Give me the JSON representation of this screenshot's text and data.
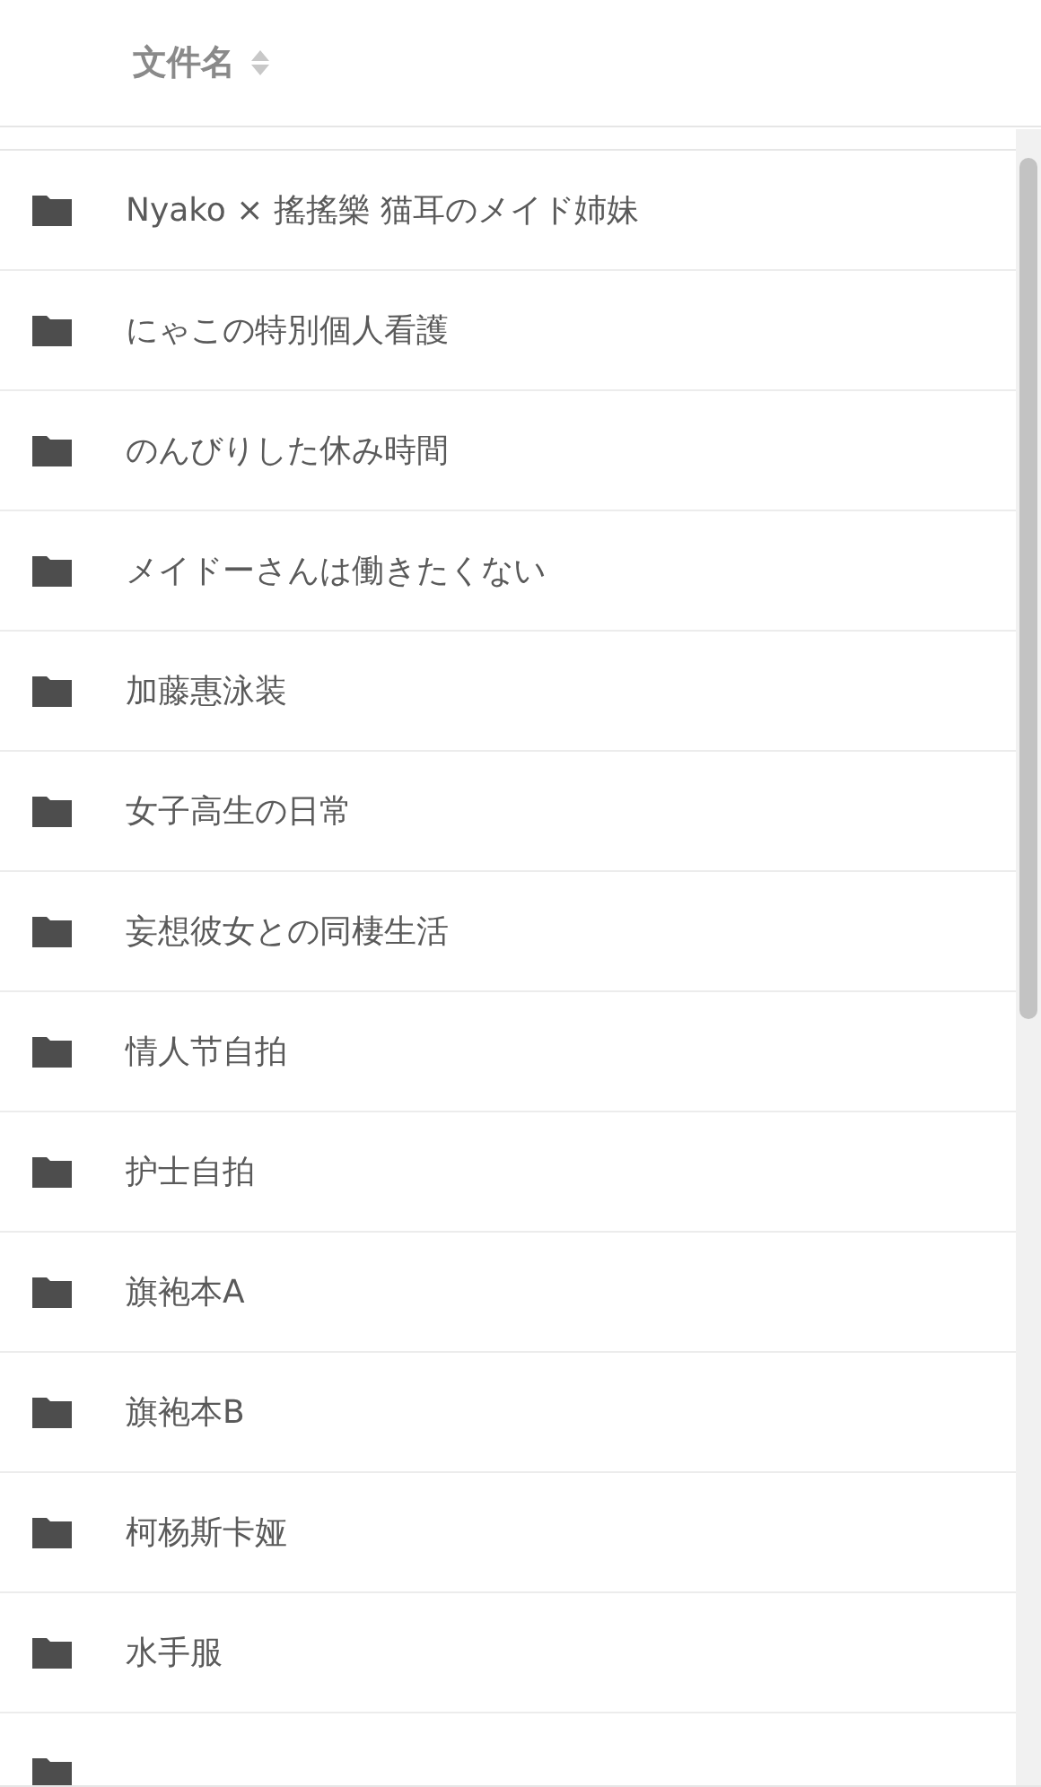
{
  "table": {
    "columns": [
      {
        "label": "文件名",
        "sortable": true
      }
    ],
    "rows": [
      {
        "name": "Nyako × 搖搖樂 猫耳のメイド姉妹",
        "kind": "folder"
      },
      {
        "name": "にゃこの特別個人看護",
        "kind": "folder"
      },
      {
        "name": "のんびりした休み時間",
        "kind": "folder"
      },
      {
        "name": "メイドーさんは働きたくない",
        "kind": "folder"
      },
      {
        "name": "加藤惠泳装",
        "kind": "folder"
      },
      {
        "name": "女子高生の日常",
        "kind": "folder"
      },
      {
        "name": "妄想彼女との同棲生活",
        "kind": "folder"
      },
      {
        "name": "情人节自拍",
        "kind": "folder"
      },
      {
        "name": "护士自拍",
        "kind": "folder"
      },
      {
        "name": "旗袍本A",
        "kind": "folder"
      },
      {
        "name": "旗袍本B",
        "kind": "folder"
      },
      {
        "name": "柯杨斯卡娅",
        "kind": "folder"
      },
      {
        "name": "水手服",
        "kind": "folder"
      },
      {
        "kind": "folder"
      }
    ]
  }
}
